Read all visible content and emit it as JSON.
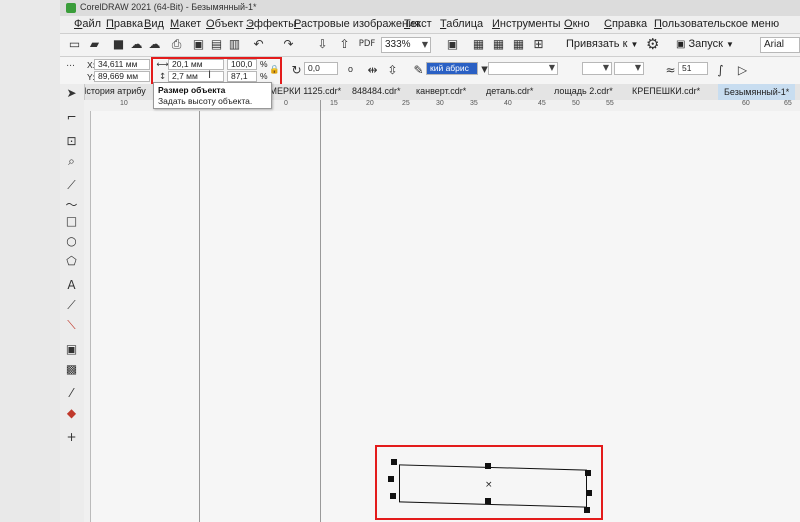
{
  "window": {
    "title": "CorelDRAW 2021 (64-Bit) - Безымянный-1*"
  },
  "menu": [
    "Файл",
    "Правка",
    "Вид",
    "Макет",
    "Объект",
    "Эффекты",
    "Растровые изображения",
    "Текст",
    "Таблица",
    "Инструменты",
    "Окно",
    "Справка",
    "Пользовательское меню"
  ],
  "toolbar1": {
    "zoom": "333%",
    "snap_label": "Привязать к",
    "launch_label": "Запуск",
    "font": "Arial",
    "pdf_label": "PDF"
  },
  "toolbar2": {
    "x_label": "X:",
    "x_value": "34,611 мм",
    "y_label": "Y:",
    "y_value": "89,669 мм",
    "width_value": "20,1 мм",
    "height_value": "2,7 мм",
    "scale_w": "100,0",
    "scale_h": "87,1",
    "pct": "%",
    "rotation": "0,0",
    "outline_label": "кий абрис",
    "corner_value": "51"
  },
  "tooltip": {
    "title": "Размер объекта",
    "desc": "Задать высоту объекта."
  },
  "tabs": {
    "history": "История атрибу",
    "items": [
      "НОМЕРКИ 1125.cdr*",
      "848484.cdr*",
      "канверт.cdr*",
      "деталь.cdr*",
      "лощадь 2.cdr*",
      "КРЕПЕШКИ.cdr*",
      "Безымянный-1*"
    ]
  },
  "ruler_labels": [
    "10",
    "5",
    "0",
    "15",
    "20",
    "25",
    "30",
    "35",
    "40",
    "45",
    "50",
    "55",
    "60",
    "65"
  ],
  "colors": {
    "highlight": "#e31b1b",
    "active_tab": "#c8ddf0",
    "app_green": "#3a9d3a"
  }
}
